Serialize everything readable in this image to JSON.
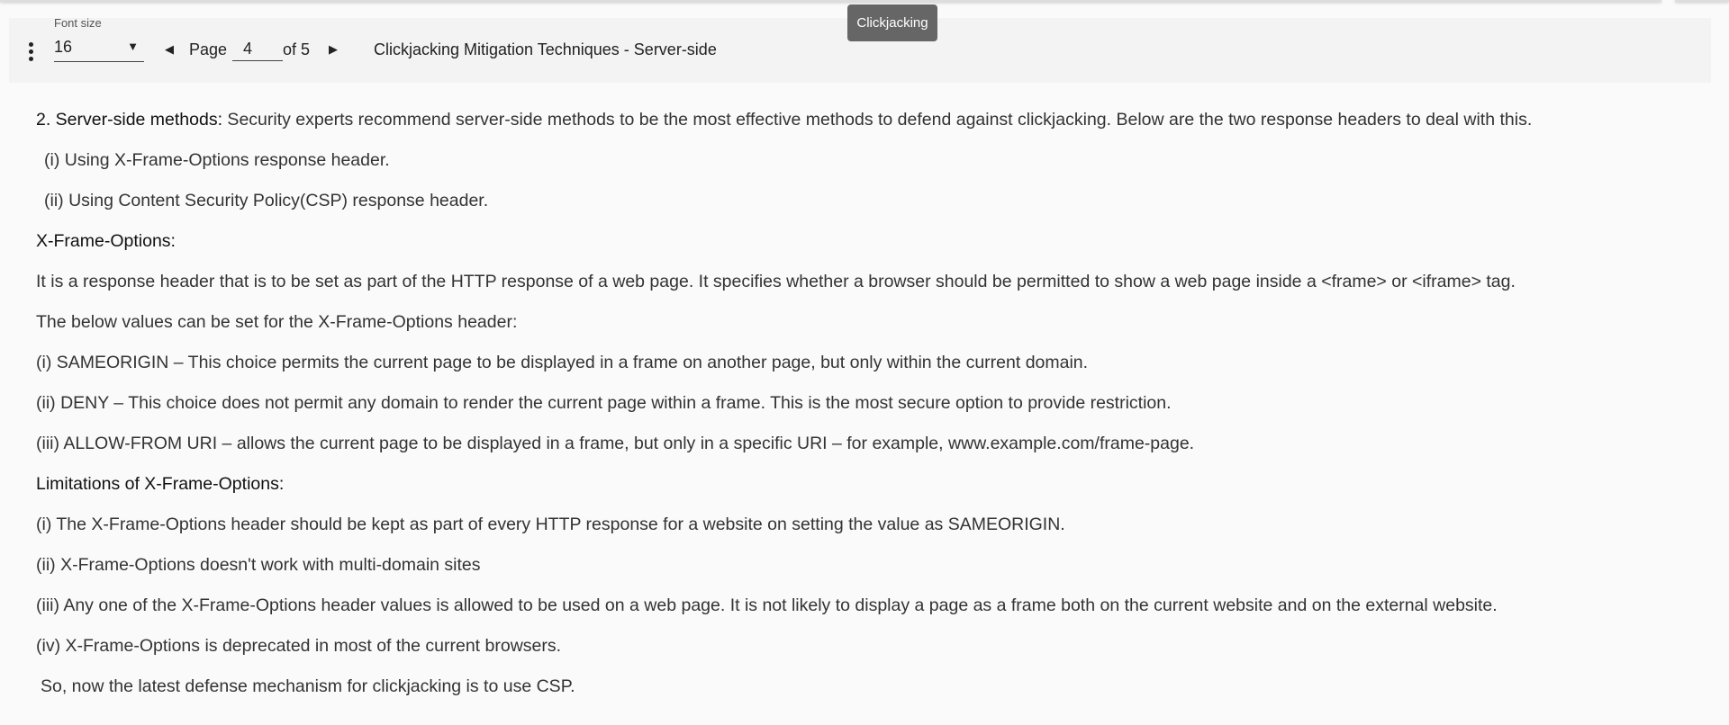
{
  "toolbar": {
    "font_size_label": "Font size",
    "font_size_value": "16",
    "page_label": "Page",
    "page_value": "4",
    "page_of": "of 5",
    "doc_title": "Clickjacking Mitigation Techniques - Server-side"
  },
  "tooltip": "Clickjacking",
  "content": {
    "intro_bold": "2. Server-side methods:",
    "intro_text": " Security experts recommend server-side methods to be the most effective methods to defend against clickjacking. Below are the two response headers to deal with this.",
    "lines": [
      "(i) Using X-Frame-Options response header.",
      "(ii) Using Content Security Policy(CSP) response header."
    ],
    "xfo_heading": "X-Frame-Options:",
    "xfo_lines": [
      "It is a response header that is to be set as part of the HTTP response of a web page. It specifies whether a browser should be permitted to show a web page inside a <frame> or <iframe> tag.",
      "The below values can be set for the X-Frame-Options header:",
      "(i) SAMEORIGIN – This choice permits the current page to be displayed in a frame on another page, but only within the current domain.",
      "(ii) DENY – This choice does not permit any domain to render the current page within a frame. This is the most secure option to provide restriction.",
      "(iii) ALLOW-FROM URI – allows the current page to be displayed in a frame, but only in a specific URI – for example, www.example.com/frame-page."
    ],
    "limits_heading": "Limitations of X-Frame-Options:",
    "limits_lines": [
      "(i) The X-Frame-Options header should be kept as part of every HTTP response for a website on setting the value as SAMEORIGIN.",
      "(ii) X-Frame-Options doesn't work with multi-domain sites",
      "(iii) Any one of the X-Frame-Options header values is allowed to be used on a web page. It is not likely to display a page as a frame both on the current website and on the external website.",
      "(iv) X-Frame-Options is deprecated in most of the current browsers."
    ],
    "closing": "So, now the latest defense mechanism for clickjacking is to use CSP."
  }
}
